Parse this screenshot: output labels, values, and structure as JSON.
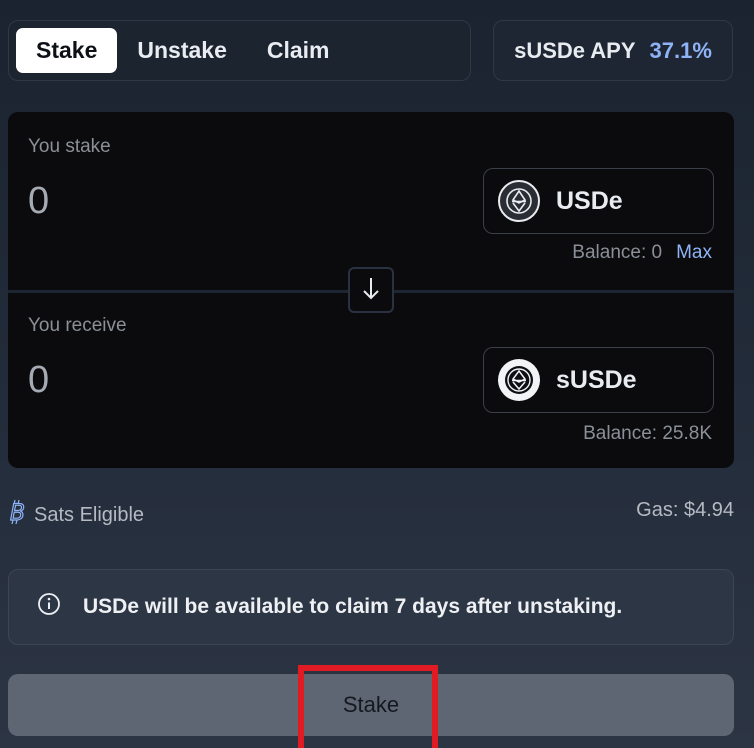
{
  "tabs": [
    {
      "label": "Stake",
      "active": true
    },
    {
      "label": "Unstake",
      "active": false
    },
    {
      "label": "Claim",
      "active": false
    }
  ],
  "apy": {
    "label": "sUSDe APY",
    "value": "37.1%",
    "value_color": "#8fb3f7"
  },
  "stake_section": {
    "label": "You stake",
    "amount": "0",
    "token": {
      "symbol": "USDe",
      "icon": "ethena-usde-icon"
    },
    "balance": "Balance: 0",
    "max_label": "Max"
  },
  "swap": {
    "icon": "arrow-down-icon"
  },
  "receive_section": {
    "label": "You receive",
    "amount": "0",
    "token": {
      "symbol": "sUSDe",
      "icon": "ethena-susde-icon"
    },
    "balance": "Balance: 25.8K"
  },
  "info_row": {
    "sats_label": "Sats Eligible",
    "sats_icon": "bitcoin-icon",
    "gas": "Gas: $4.94"
  },
  "notice": {
    "icon": "info-icon",
    "text": "USDe will be available to claim 7 days after unstaking."
  },
  "action": {
    "label": "Stake"
  },
  "colors": {
    "accent": "#8fb3f7",
    "highlight": "#e01b24",
    "panel": "#0b0b0d"
  }
}
